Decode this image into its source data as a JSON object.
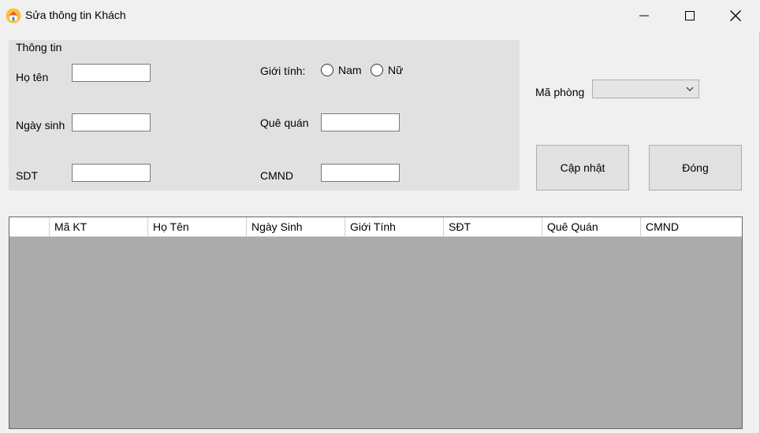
{
  "window": {
    "title": "Sửa thông tin Khách"
  },
  "group": {
    "title": "Thông tin",
    "ho_ten_label": "Họ tên",
    "ngay_sinh_label": "Ngày sinh",
    "sdt_label": "SDT",
    "gioi_tinh_label": "Giới tính:",
    "gioi_tinh_options": [
      "Nam",
      "Nữ"
    ],
    "que_quan_label": "Quê quán",
    "cmnd_label": "CMND",
    "ho_ten_value": "",
    "ngay_sinh_value": "",
    "sdt_value": "",
    "que_quan_value": "",
    "cmnd_value": ""
  },
  "ma_phong": {
    "label": "Mã phòng",
    "selected": ""
  },
  "buttons": {
    "update": "Cập nhật",
    "close": "Đóng"
  },
  "table": {
    "columns": [
      "Mã KT",
      "Họ Tên",
      "Ngày Sinh",
      "Giới Tính",
      "SĐT",
      "Quê Quán",
      "CMND"
    ],
    "rows": []
  }
}
